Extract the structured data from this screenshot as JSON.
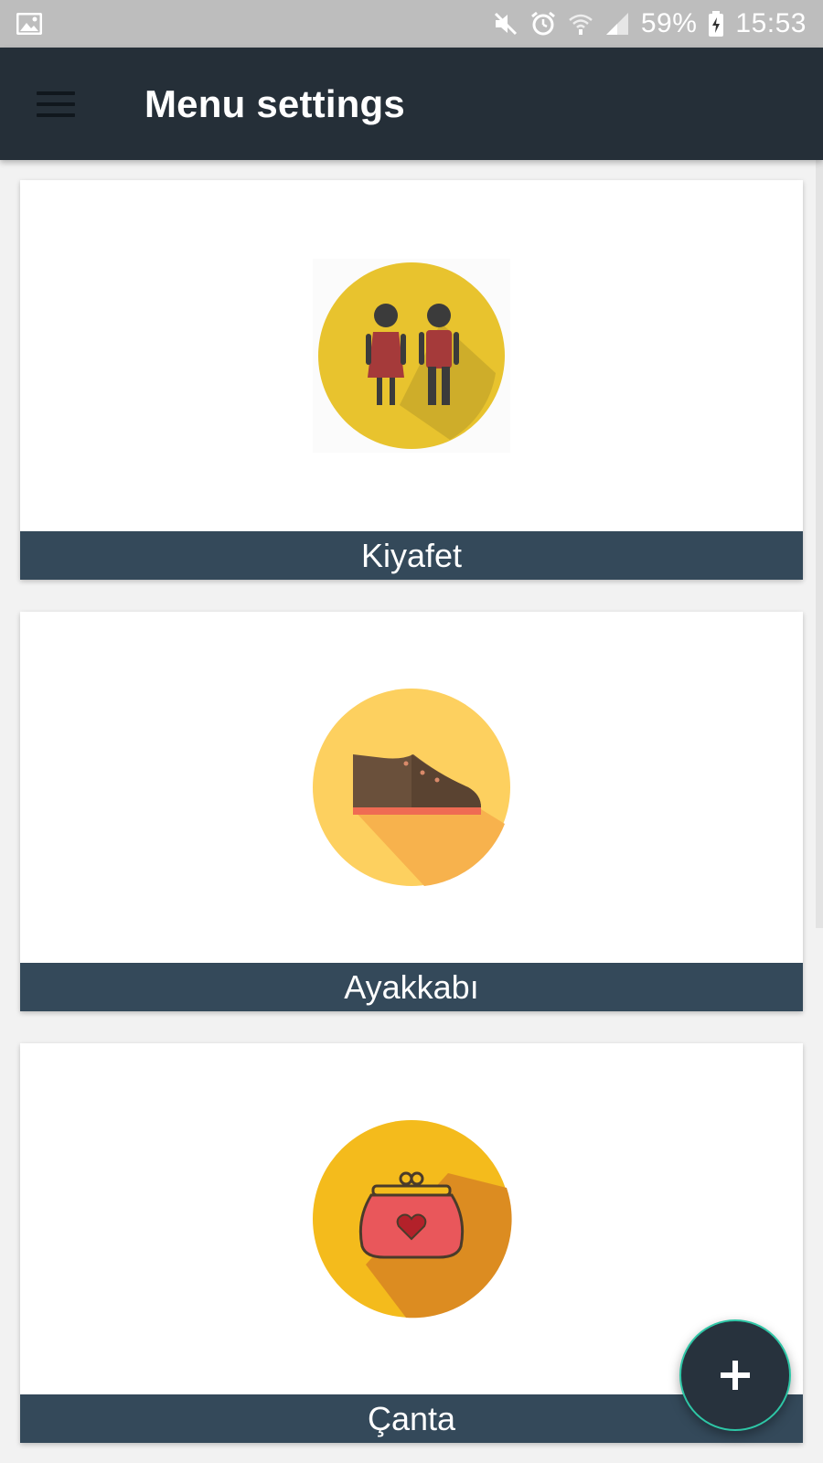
{
  "status_bar": {
    "battery": "59%",
    "time": "15:53",
    "icons": [
      "image-icon",
      "mute-icon",
      "alarm-icon",
      "wifi-icon",
      "signal-icon",
      "battery-charging-icon"
    ]
  },
  "app_bar": {
    "title": "Menu settings",
    "menu_icon": "hamburger-menu-icon",
    "background": "#252f38"
  },
  "categories": [
    {
      "label": "Kiyafet",
      "icon": "clothing-couple-icon",
      "circle_color": "#e8c32e"
    },
    {
      "label": "Ayakkabı",
      "icon": "shoe-icon",
      "circle_color": "#fdd05f"
    },
    {
      "label": "Çanta",
      "icon": "purse-icon",
      "circle_color": "#f4bb1c"
    }
  ],
  "colors": {
    "label_bar": "#34495a",
    "fab_border": "#2ec6a6"
  },
  "fab": {
    "icon": "plus-icon"
  }
}
